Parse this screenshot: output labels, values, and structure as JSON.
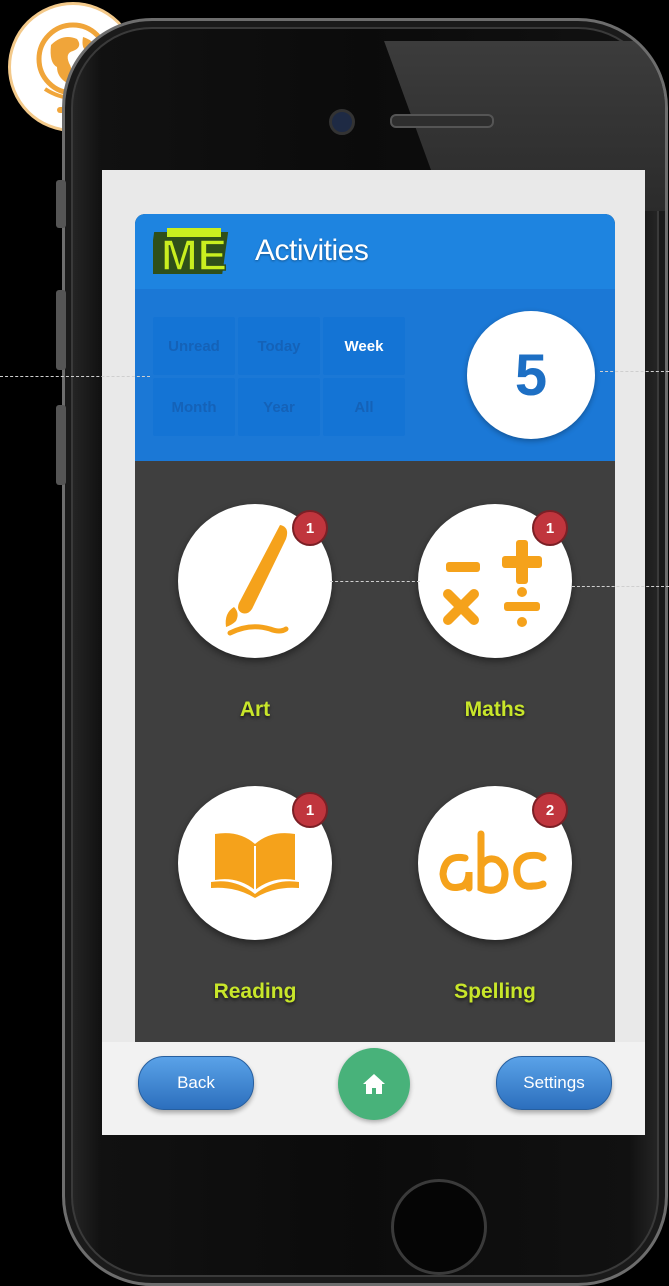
{
  "header": {
    "title": "Activities",
    "logo_text": "ME"
  },
  "filters": [
    {
      "label": "Unread",
      "active": false
    },
    {
      "label": "Today",
      "active": false
    },
    {
      "label": "Week",
      "active": true
    },
    {
      "label": "Month",
      "active": false
    },
    {
      "label": "Year",
      "active": false
    },
    {
      "label": "All",
      "active": false
    }
  ],
  "count": "5",
  "activities": [
    {
      "label": "Art",
      "badge": "1",
      "icon": "paintbrush-icon"
    },
    {
      "label": "Maths",
      "badge": "1",
      "icon": "math-operators-icon"
    },
    {
      "label": "Reading",
      "badge": "1",
      "icon": "open-book-icon"
    },
    {
      "label": "Spelling",
      "badge": "2",
      "icon": "abc-icon"
    }
  ],
  "footer": {
    "back_label": "Back",
    "home_icon": "home-icon",
    "settings_label": "Settings"
  },
  "colors": {
    "header_blue": "#1e84e0",
    "panel_dark": "#3f3f3f",
    "label_green": "#c8e62a",
    "icon_orange": "#f5a21b",
    "badge_red": "#c0353d",
    "home_green": "#48b27a"
  }
}
